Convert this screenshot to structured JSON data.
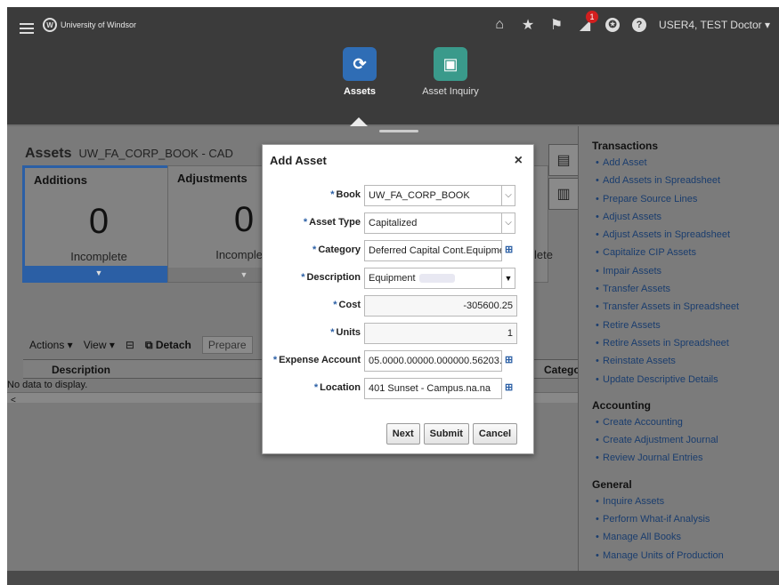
{
  "header": {
    "logo_text": "University of Windsor",
    "user": "USER4, TEST Doctor",
    "notification_count": "1",
    "accessibility_glyph": "✪",
    "help_glyph": "?"
  },
  "nav": {
    "apps": [
      {
        "label": "Assets",
        "icon": "assets-icon",
        "color": "#2f6db5",
        "active": true
      },
      {
        "label": "Asset Inquiry",
        "icon": "asset-inquiry-icon",
        "color": "#3a9a8b",
        "active": false
      }
    ]
  },
  "page": {
    "title": "Assets",
    "book": "UW_FA_CORP_BOOK - CAD"
  },
  "cards": [
    {
      "title": "Additions",
      "count": "0",
      "label": "Incomplete"
    },
    {
      "title": "Adjustments",
      "count": "0",
      "label": "Incomplete"
    },
    {
      "partial_label": "lete"
    }
  ],
  "toolbar": {
    "actions": "Actions ▾",
    "view": "View ▾",
    "detach": "Detach",
    "prepare": "Prepare"
  },
  "table": {
    "columns": [
      "Description",
      "Catego"
    ],
    "empty_text": "No data to display.",
    "scroll_left": "<"
  },
  "right_panel": {
    "sections": [
      {
        "title": "Transactions",
        "items": [
          "Add Asset",
          "Add Assets in Spreadsheet",
          "Prepare Source Lines",
          "Adjust Assets",
          "Adjust Assets in Spreadsheet",
          "Capitalize CIP Assets",
          "Impair Assets",
          "Transfer Assets",
          "Transfer Assets in Spreadsheet",
          "Retire Assets",
          "Retire Assets in Spreadsheet",
          "Reinstate Assets",
          "Update Descriptive Details"
        ]
      },
      {
        "title": "Accounting",
        "items": [
          "Create Accounting",
          "Create Adjustment Journal",
          "Review Journal Entries"
        ]
      },
      {
        "title": "General",
        "items": [
          "Inquire Assets",
          "Perform What-if Analysis",
          "Manage All Books",
          "Manage Units of Production"
        ]
      }
    ]
  },
  "dialog": {
    "title": "Add Asset",
    "close": "×",
    "fields": {
      "book": {
        "label": "Book",
        "value": "UW_FA_CORP_BOOK"
      },
      "asset_type": {
        "label": "Asset Type",
        "value": "Capitalized"
      },
      "category": {
        "label": "Category",
        "value": "Deferred Capital Cont.Equipme"
      },
      "description": {
        "label": "Description",
        "value": "Equipment"
      },
      "cost": {
        "label": "Cost",
        "value": "-305600.25"
      },
      "units": {
        "label": "Units",
        "value": "1"
      },
      "expense_account": {
        "label": "Expense Account",
        "value": "05.0000.00000.000000.56203."
      },
      "location": {
        "label": "Location",
        "value": "401 Sunset - Campus.na.na"
      }
    },
    "buttons": {
      "next": "Next",
      "submit": "Submit",
      "cancel": "Cancel"
    }
  }
}
